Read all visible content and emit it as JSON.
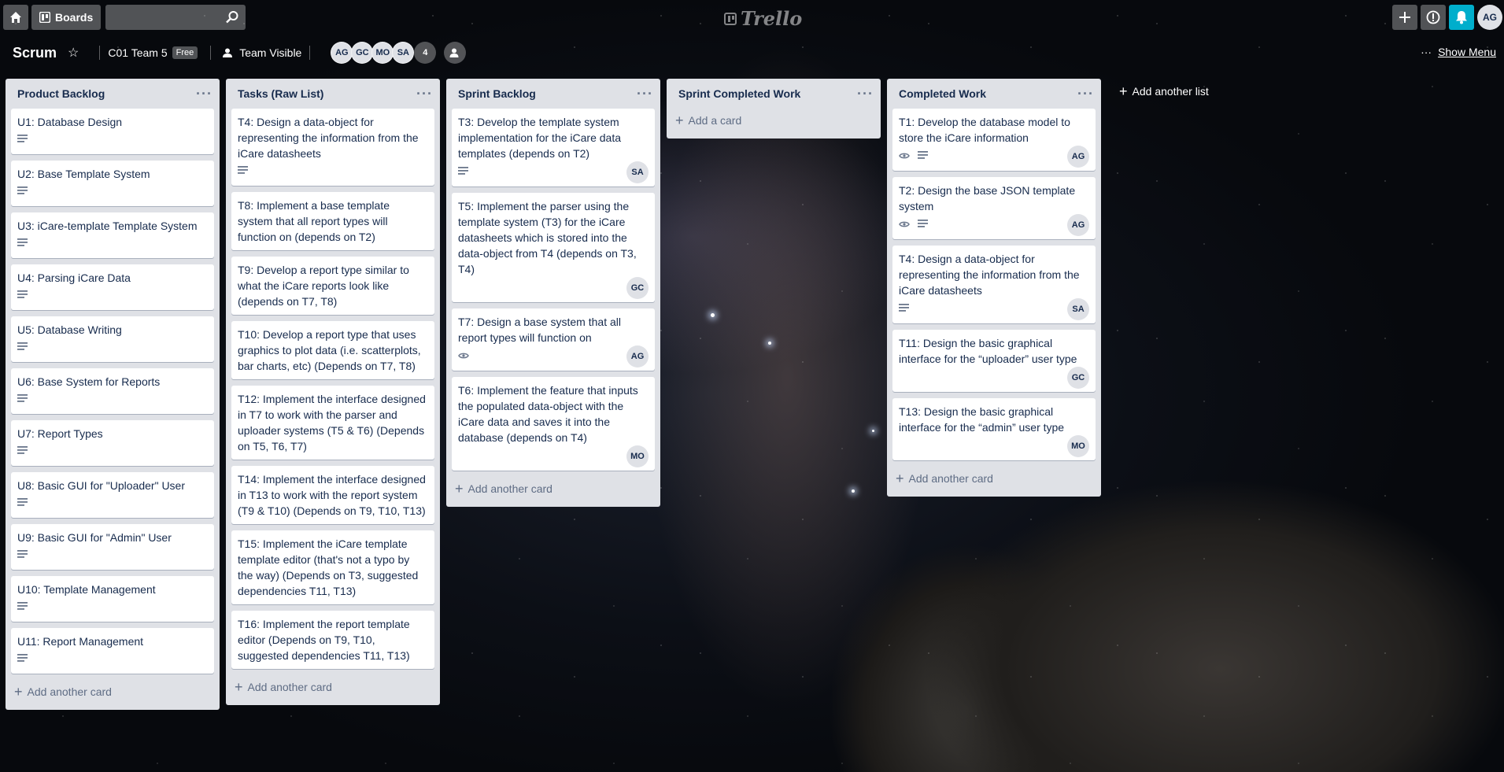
{
  "header": {
    "boards_label": "Boards",
    "search_placeholder": "",
    "logo_text": "Trello",
    "user_initials": "AG"
  },
  "board": {
    "title": "Scrum",
    "team_name": "C01 Team 5",
    "plan_badge": "Free",
    "visibility": "Team Visible",
    "members": [
      "AG",
      "GC",
      "MO",
      "SA"
    ],
    "member_overflow": "4",
    "show_menu": "Show Menu"
  },
  "lists": [
    {
      "title": "Product Backlog",
      "add_card": "Add another card",
      "cards": [
        {
          "title": "U1: Database Design",
          "description": true
        },
        {
          "title": "U2: Base Template System",
          "description": true
        },
        {
          "title": "U3: iCare-template Template System",
          "description": true
        },
        {
          "title": "U4: Parsing iCare Data",
          "description": true
        },
        {
          "title": "U5: Database Writing",
          "description": true
        },
        {
          "title": "U6: Base System for Reports",
          "description": true
        },
        {
          "title": "U7: Report Types",
          "description": true
        },
        {
          "title": "U8: Basic GUI for \"Uploader\" User",
          "description": true
        },
        {
          "title": "U9: Basic GUI for \"Admin\" User",
          "description": true
        },
        {
          "title": "U10: Template Management",
          "description": true
        },
        {
          "title": "U11: Report Management",
          "description": true
        }
      ]
    },
    {
      "title": "Tasks (Raw List)",
      "add_card": "Add another card",
      "cards": [
        {
          "title": "T4: Design a data-object for representing the information from the iCare datasheets",
          "description": true
        },
        {
          "title": "T8: Implement a base template system that all report types will function on (depends on T2)"
        },
        {
          "title": "T9: Develop a report type similar to what the iCare reports look like (depends on T7, T8)"
        },
        {
          "title": "T10: Develop a report type that uses graphics to plot data (i.e. scatterplots, bar charts, etc) (Depends on T7, T8)"
        },
        {
          "title": "T12: Implement the interface designed in T7 to work with the parser and uploader systems (T5 & T6) (Depends on T5, T6, T7)"
        },
        {
          "title": "T14: Implement the interface designed in T13 to work with the report system (T9 & T10) (Depends on T9, T10, T13)"
        },
        {
          "title": "T15: Implement the iCare template template editor (that's not a typo by the way) (Depends on T3, suggested dependencies T11, T13)"
        },
        {
          "title": "T16: Implement the report template editor (Depends on T9, T10, suggested dependencies T11, T13)"
        }
      ]
    },
    {
      "title": "Sprint Backlog",
      "add_card": "Add another card",
      "cards": [
        {
          "title": "T3: Develop the template system implementation for the iCare data templates (depends on T2)",
          "description": true,
          "member": "SA"
        },
        {
          "title": "T5: Implement the parser using the template system (T3) for the iCare datasheets which is stored into the data-object from T4 (depends on T3, T4)",
          "member": "GC"
        },
        {
          "title": "T7: Design a base system that all report types will function on",
          "watch": true,
          "member": "AG"
        },
        {
          "title": "T6: Implement the feature that inputs the populated data-object with the iCare data and saves it into the database (depends on T4)",
          "member": "MO"
        }
      ]
    },
    {
      "title": "Sprint Completed Work",
      "add_card": "Add a card",
      "cards": []
    },
    {
      "title": "Completed Work",
      "add_card": "Add another card",
      "cards": [
        {
          "title": "T1: Develop the database model to store the iCare information",
          "watch": true,
          "description": true,
          "member": "AG"
        },
        {
          "title": "T2: Design the base JSON template system",
          "watch": true,
          "description": true,
          "member": "AG"
        },
        {
          "title": "T4: Design a data-object for representing the information from the iCare datasheets",
          "description": true,
          "member": "SA"
        },
        {
          "title": "T11: Design the basic graphical interface for the “uploader” user type",
          "member": "GC"
        },
        {
          "title": "T13: Design the basic graphical interface for the “admin” user type",
          "member": "MO"
        }
      ]
    }
  ],
  "add_list": "Add another list"
}
